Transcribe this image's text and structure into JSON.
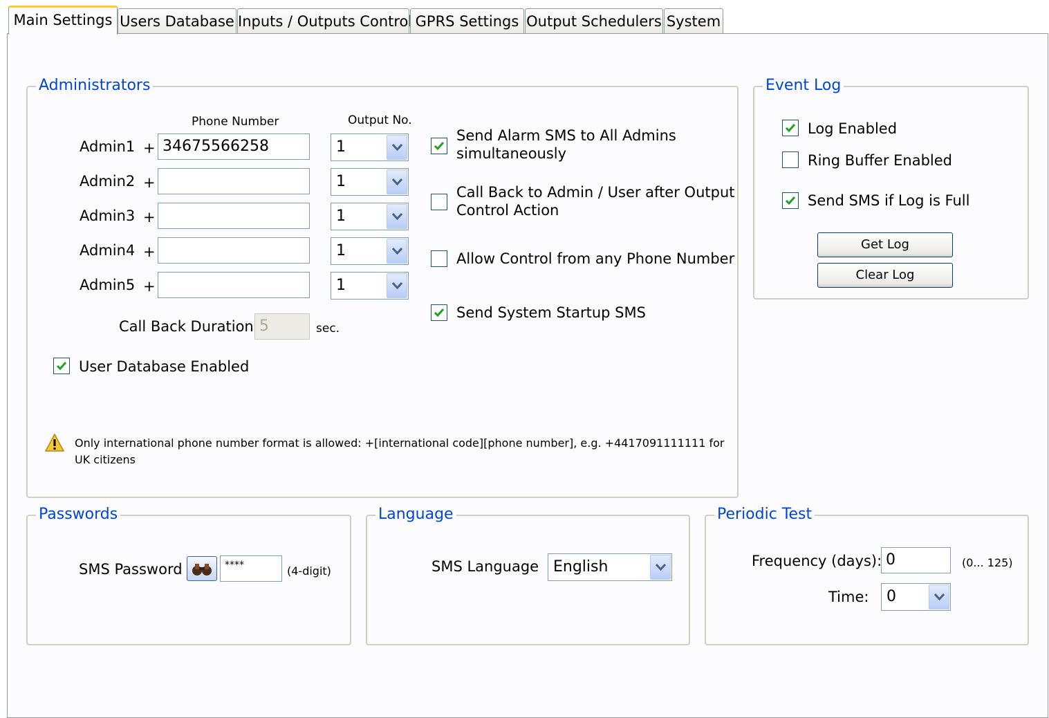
{
  "tabs": [
    "Main Settings",
    "Users Database",
    "Inputs / Outputs Control",
    "GPRS Settings",
    "Output Schedulers",
    "System"
  ],
  "administrators": {
    "title": "Administrators",
    "phone_header": "Phone Number",
    "output_header": "Output No.",
    "admins": [
      {
        "label": "Admin1",
        "plus": "+",
        "phone": "34675566258",
        "output": "1"
      },
      {
        "label": "Admin2",
        "plus": "+",
        "phone": "",
        "output": "1"
      },
      {
        "label": "Admin3",
        "plus": "+",
        "phone": "",
        "output": "1"
      },
      {
        "label": "Admin4",
        "plus": "+",
        "phone": "",
        "output": "1"
      },
      {
        "label": "Admin5",
        "plus": "+",
        "phone": "",
        "output": "1"
      }
    ],
    "callback_label": "Call Back Duration",
    "callback_value": "5",
    "callback_unit": "sec.",
    "user_db": {
      "label": "User Database Enabled",
      "checked": true
    },
    "options": [
      {
        "line1": "Send Alarm SMS to All Admins",
        "line2": "simultaneously",
        "checked": true
      },
      {
        "line1": "Call Back to Admin / User after Output",
        "line2": "Control Action",
        "checked": false
      },
      {
        "line1": "Allow Control from any Phone Number",
        "line2": "",
        "checked": false
      },
      {
        "line1": "Send System Startup SMS",
        "line2": "",
        "checked": true
      }
    ],
    "warning_line1": "Only international phone number format is allowed: +[international code][phone number], e.g. +4417091111111 for",
    "warning_line2": "UK citizens"
  },
  "event_log": {
    "title": "Event Log",
    "options": [
      {
        "label": "Log Enabled",
        "checked": true
      },
      {
        "label": "Ring Buffer Enabled",
        "checked": false
      },
      {
        "label": "Send SMS if Log is Full",
        "checked": true
      }
    ],
    "get_button": "Get Log",
    "clear_button": "Clear Log"
  },
  "passwords": {
    "title": "Passwords",
    "sms_label": "SMS Password",
    "sms_value": "****",
    "hint": "(4-digit)"
  },
  "language": {
    "title": "Language",
    "label": "SMS Language",
    "value": "English"
  },
  "periodic_test": {
    "title": "Periodic Test",
    "freq_label": "Frequency (days):",
    "freq_value": "0",
    "freq_range": "(0... 125)",
    "time_label": "Time:",
    "time_value": "0"
  },
  "colors": {
    "legend": "#0046d5",
    "check": "#21a121",
    "active_tab": "#ffc83c"
  }
}
